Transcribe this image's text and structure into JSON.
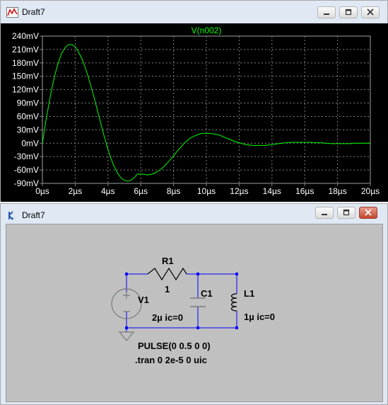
{
  "waveform_window": {
    "title": "Draft7",
    "trace_name": "V(n002)"
  },
  "schematic_window": {
    "title": "Draft7",
    "components": {
      "r1_name": "R1",
      "r1_value": "1",
      "v1_name": "V1",
      "c1_name": "C1",
      "c1_value": "2µ ic=0",
      "l1_name": "L1",
      "l1_value": "1µ ic=0",
      "source_spec": "PULSE(0 0.5 0 0)",
      "directive": ".tran 0 2e-5 0 uic"
    }
  },
  "chart_data": {
    "type": "line",
    "title": "V(n002)",
    "xlabel": "",
    "ylabel": "",
    "x_ticks": [
      "0µs",
      "2µs",
      "4µs",
      "6µs",
      "8µs",
      "10µs",
      "12µs",
      "14µs",
      "16µs",
      "18µs",
      "20µs"
    ],
    "y_ticks": [
      "240mV",
      "210mV",
      "180mV",
      "150mV",
      "120mV",
      "90mV",
      "60mV",
      "30mV",
      "0mV",
      "-30mV",
      "-60mV",
      "-90mV"
    ],
    "xlim": [
      0,
      20
    ],
    "ylim": [
      -90,
      240
    ],
    "x_unit": "µs",
    "y_unit": "mV",
    "grid": true,
    "colors": {
      "background": "#000000",
      "trace": "#00ff00",
      "grid": "#808080",
      "axis_text": "#ffffff"
    },
    "series": [
      {
        "name": "V(n002)",
        "x": [
          0,
          0.2,
          0.4,
          0.6,
          0.8,
          1,
          1.2,
          1.4,
          1.6,
          1.8,
          2,
          2.2,
          2.4,
          2.6,
          2.8,
          3,
          3.2,
          3.4,
          3.6,
          3.8,
          4,
          4.2,
          4.4,
          4.6,
          4.8,
          5,
          5.2,
          5.4,
          5.6,
          5.8,
          6,
          6.2,
          6.4,
          6.6,
          6.8,
          7,
          7.2,
          7.4,
          7.6,
          7.8,
          8,
          8.2,
          8.4,
          8.6,
          8.8,
          9,
          9.2,
          9.4,
          9.6,
          9.8,
          10,
          10.2,
          10.4,
          10.6,
          10.8,
          11,
          11.2,
          11.4,
          11.6,
          11.8,
          12,
          12.2,
          12.4,
          12.6,
          12.8,
          13,
          13.2,
          13.4,
          13.6,
          13.8,
          14,
          14.2,
          14.4,
          14.6,
          14.8,
          15,
          15.2,
          15.4,
          15.6,
          15.8,
          16,
          16.2,
          16.4,
          16.6,
          16.8,
          17,
          17.2,
          17.4,
          17.6,
          17.8,
          18,
          18.2,
          18.4,
          18.6,
          18.8,
          19,
          19.2,
          19.4,
          19.6,
          19.8,
          20
        ],
        "y": [
          0,
          47,
          89,
          127,
          159,
          184,
          203,
          215,
          221,
          221,
          216,
          205,
          190,
          171,
          148,
          123,
          96,
          67,
          39,
          11,
          -14,
          -36,
          -54,
          -68,
          -78,
          -83,
          -85,
          -83,
          -77,
          -69,
          -69,
          -70,
          -71,
          -70,
          -68,
          -64,
          -59,
          -53,
          -45,
          -37,
          -28,
          -19,
          -11,
          -2,
          5,
          11,
          15,
          18,
          21,
          22,
          22,
          22,
          21,
          20,
          18,
          15,
          12,
          9,
          6,
          3,
          1,
          -1,
          -3,
          -4,
          -5,
          -5,
          -5,
          -5,
          -5,
          -4,
          -3,
          -2,
          -1,
          0,
          1,
          1,
          2,
          2,
          2,
          2,
          2,
          2,
          2,
          1,
          1,
          1,
          0,
          0,
          -1,
          -1,
          -1,
          -1,
          -1,
          -1,
          -1,
          0,
          0,
          0,
          0,
          0,
          0
        ]
      }
    ]
  }
}
